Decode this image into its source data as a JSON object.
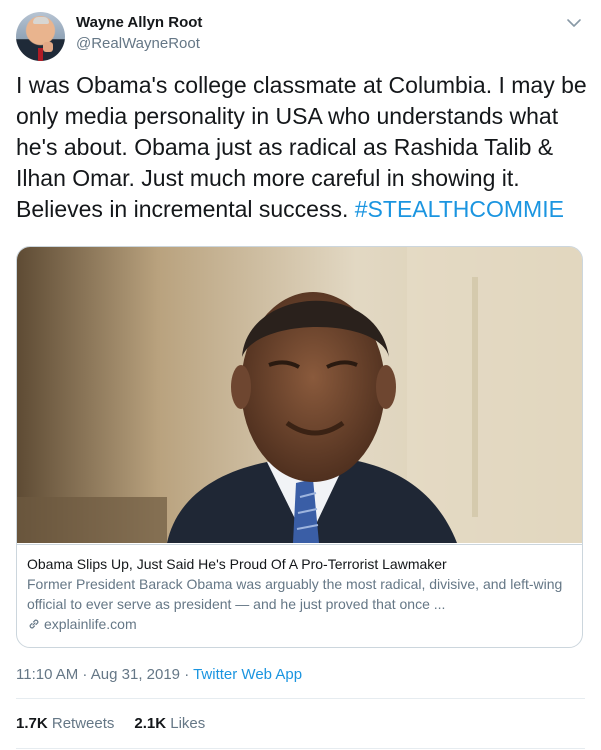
{
  "author": {
    "name": "Wayne Allyn Root",
    "handle": "@RealWayneRoot"
  },
  "tweet": {
    "text": "I was Obama's college classmate at Columbia. I may be only media personality in USA who understands what he's about. Obama just as radical as Rashida Talib & Ilhan Omar. Just much more careful in showing it. Believes in incremental success. ",
    "hashtag": "#STEALTHCOMMIE"
  },
  "card": {
    "title": "Obama Slips Up, Just Said He's Proud Of A Pro-Terrorist Lawmaker",
    "description": "Former President Barack Obama was arguably the most radical, divisive, and left-wing official to ever serve as president — and he just proved that once ...",
    "domain": "explainlife.com"
  },
  "meta": {
    "time": "11:10 AM",
    "separator1": " · ",
    "date": "Aug 31, 2019",
    "separator2": " · ",
    "app": "Twitter Web App"
  },
  "stats": {
    "retweets_count": "1.7K",
    "retweets_label": "Retweets",
    "likes_count": "2.1K",
    "likes_label": "Likes"
  },
  "icons": {
    "menu": "chevron-down-icon",
    "link": "link-icon"
  },
  "colors": {
    "accent": "#1b95e0",
    "secondary_text": "#657786",
    "primary_text": "#14171a",
    "border": "#ccd6dd"
  }
}
